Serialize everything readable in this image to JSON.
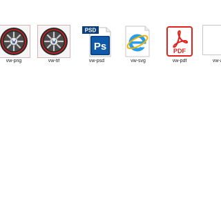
{
  "files": [
    {
      "name": "vw-png",
      "icon": "vw-wheel-thumbnail-icon"
    },
    {
      "name": "vw-tif",
      "icon": "vw-wheel-thumbnail-icon"
    },
    {
      "name": "vw-psd",
      "icon": "photoshop-psd-icon",
      "badge": "PSD",
      "glyph": "Ps",
      "accent": "#0f5aa8"
    },
    {
      "name": "vw-svg",
      "icon": "internet-explorer-icon",
      "accent": "#2a9ee6"
    },
    {
      "name": "vw-pdf",
      "icon": "pdf-document-icon",
      "glyph": "PDF",
      "accent": "#e1221c"
    },
    {
      "name": "vw-ai",
      "icon": "blank-document-icon"
    }
  ],
  "colors": {
    "background": "#ffffff",
    "label_text": "#1b1b1b",
    "wheel_rim": "#2b2b2b",
    "wheel_red": "#d61f1f"
  }
}
